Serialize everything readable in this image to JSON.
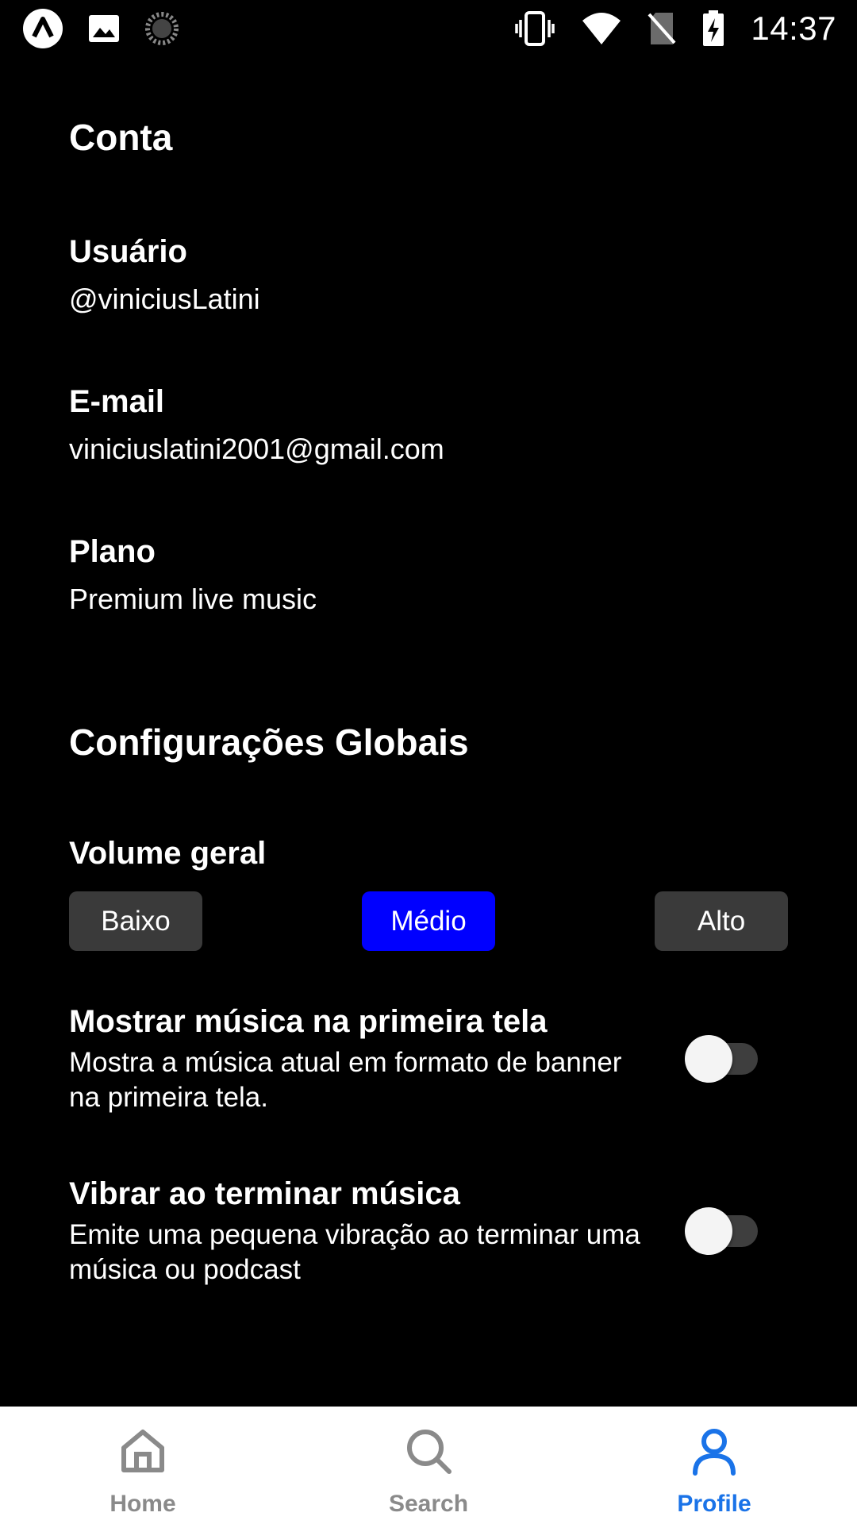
{
  "status_bar": {
    "time": "14:37",
    "left_icons": [
      "app-logo-icon",
      "image-icon",
      "loading-icon"
    ],
    "right_icons": [
      "vibrate-icon",
      "wifi-icon",
      "no-sim-icon",
      "battery-charging-icon"
    ]
  },
  "account": {
    "title": "Conta",
    "user_label": "Usuário",
    "user_value": "@viniciusLatini",
    "email_label": "E-mail",
    "email_value": "viniciuslatini2001@gmail.com",
    "plan_label": "Plano",
    "plan_value": "Premium live music"
  },
  "settings": {
    "title": "Configurações Globais",
    "volume": {
      "label": "Volume geral",
      "options": [
        "Baixo",
        "Médio",
        "Alto"
      ],
      "selected": "Médio"
    },
    "toggles": [
      {
        "title": "Mostrar música na primeira tela",
        "description": "Mostra a música atual em formato de banner na primeira tela.",
        "enabled": false
      },
      {
        "title": "Vibrar ao terminar música",
        "description": "Emite uma pequena vibração ao terminar uma música ou podcast",
        "enabled": false
      }
    ]
  },
  "bottom_nav": {
    "items": [
      {
        "label": "Home",
        "icon": "home-icon",
        "active": false
      },
      {
        "label": "Search",
        "icon": "search-icon",
        "active": false
      },
      {
        "label": "Profile",
        "icon": "profile-icon",
        "active": true
      }
    ]
  },
  "colors": {
    "background": "#000000",
    "accent": "#0000ff",
    "nav_active": "#1a73e8",
    "nav_inactive": "#8a8a8a",
    "button_inactive": "#3a3a3a"
  }
}
